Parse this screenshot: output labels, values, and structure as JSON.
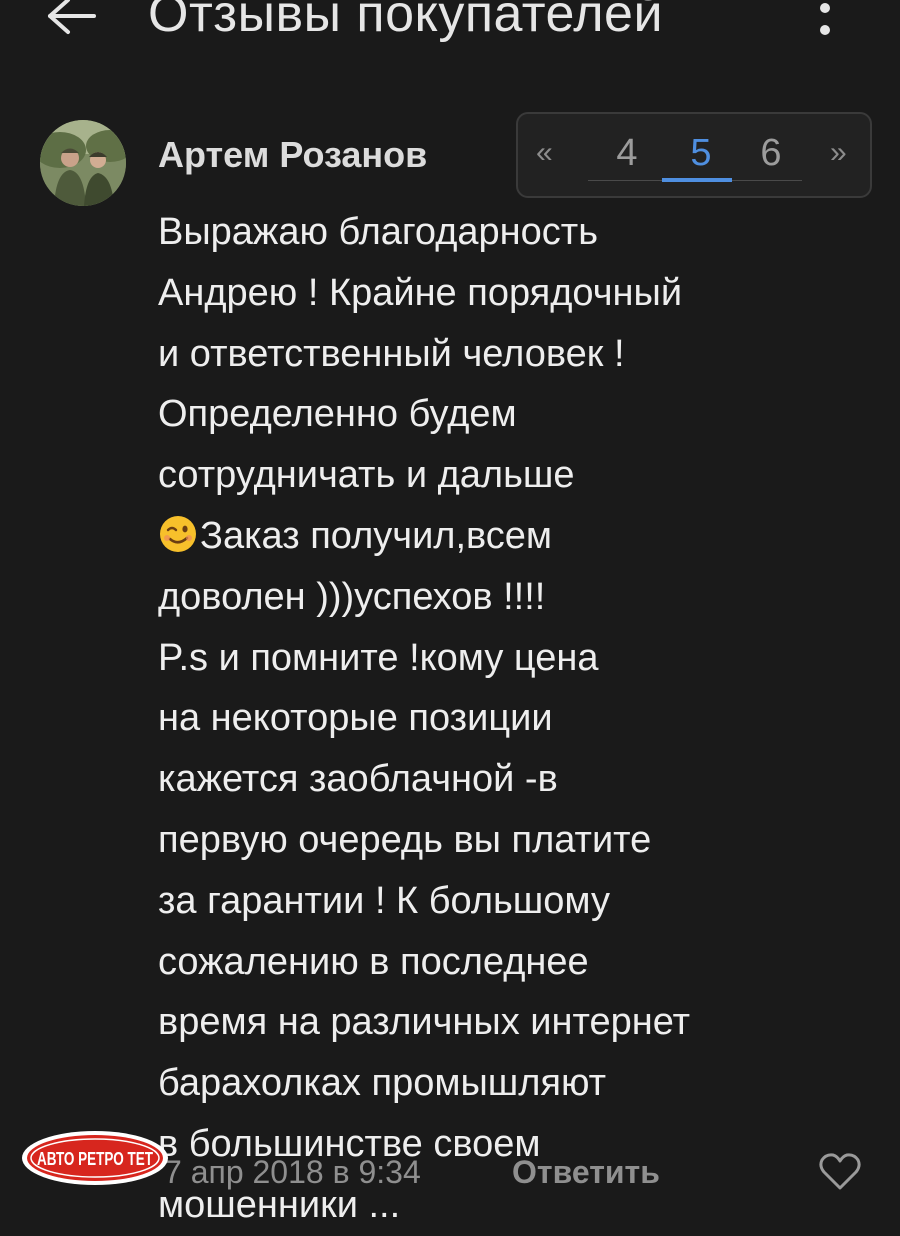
{
  "header": {
    "title": "Отзывы покупателей",
    "back_icon": "arrow-left-icon",
    "menu_icon": "more-vertical-icon"
  },
  "review": {
    "author": "Артем Розанов",
    "lines": [
      "Выражаю благодарность",
      "Андрею ! Крайне порядочный",
      "и ответственный человек !",
      "Определенно будем",
      "сотрудничать и дальше",
      "Заказ получил,всем",
      "доволен )))успехов !!!!",
      "P.s и помните !кому цена",
      "на некоторые позиции",
      "кажется заоблачной -в",
      "первую очередь вы платите",
      "за гарантии ! К большому",
      "сожалению в последнее",
      "время на различных интернет",
      "барахолках промышляют",
      "в большинстве своем",
      "мошенники ..."
    ],
    "emoji": "winking-face-emoji",
    "date": "7 апр 2018 в 9:34",
    "reply_label": "Ответить",
    "like_icon": "heart-outline-icon"
  },
  "pagination": {
    "prev": "«",
    "pages": [
      "4",
      "5",
      "6"
    ],
    "current": "5",
    "next": "»"
  },
  "watermark": {
    "text": "АВТО РЕТРО ТЕТ"
  },
  "colors": {
    "background": "#1a1a1a",
    "text": "#eeeeee",
    "muted": "#8f8f8f",
    "accent": "#4f8fe0",
    "watermark_red": "#d7261e"
  }
}
